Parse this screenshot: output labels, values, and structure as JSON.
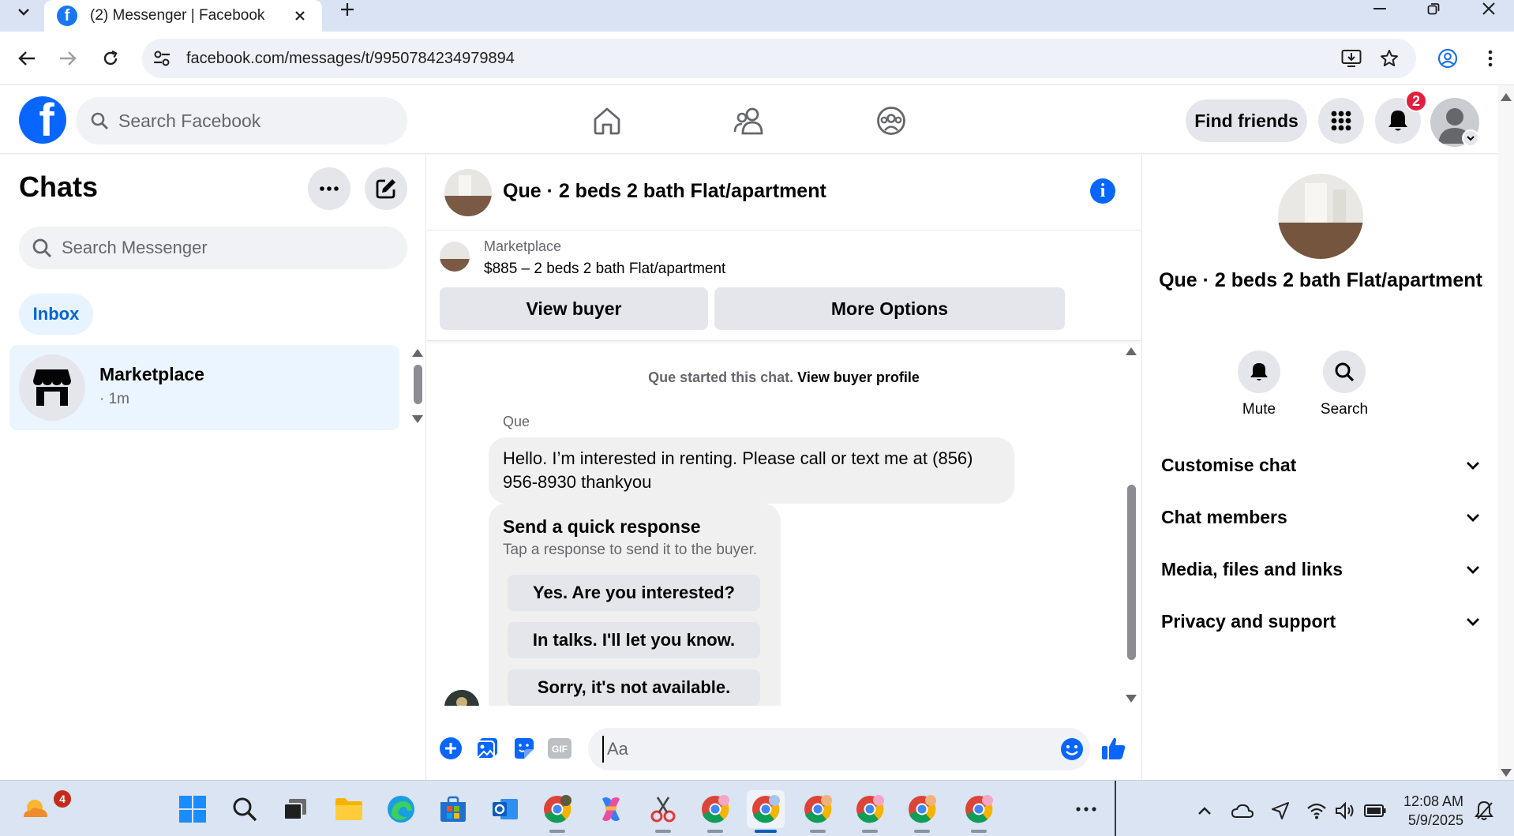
{
  "browser": {
    "tab_title": "(2) Messenger | Facebook",
    "url": "facebook.com/messages/t/9950784234979894"
  },
  "fb_nav": {
    "search_placeholder": "Search Facebook",
    "find_friends": "Find friends",
    "notification_count": "2"
  },
  "chats": {
    "title": "Chats",
    "search_placeholder": "Search Messenger",
    "inbox_label": "Inbox",
    "items": [
      {
        "name": "Marketplace",
        "time": "· 1m"
      }
    ]
  },
  "conversation": {
    "title": "Que · 2 beds 2 bath Flat/apartment",
    "listing": {
      "source": "Marketplace",
      "price_line": "$885 – 2 beds 2 bath Flat/apartment"
    },
    "buttons": {
      "view_buyer": "View buyer",
      "more_options": "More Options"
    },
    "started_text": "Que started this chat.",
    "view_buyer_profile": "View buyer profile",
    "sender": "Que",
    "message": "Hello. I’m interested in renting. Please call or text me at (856) 956-8930 thankyou",
    "quick_response": {
      "title": "Send a quick response",
      "subtitle": "Tap a response to send it to the buyer.",
      "options": [
        "Yes. Are you interested?",
        "In talks. I'll let you know.",
        "Sorry, it's not available."
      ]
    },
    "composer_placeholder": "Aa",
    "gif_label": "GIF"
  },
  "details": {
    "name": "Que · 2 beds 2 bath Flat/apartment",
    "actions": [
      {
        "label": "Mute",
        "icon": "bell-icon"
      },
      {
        "label": "Search",
        "icon": "search-icon"
      }
    ],
    "sections": [
      "Customise chat",
      "Chat members",
      "Media, files and links",
      "Privacy and support"
    ]
  },
  "taskbar": {
    "weather_badge": "4",
    "time": "12:08 AM",
    "date": "5/9/2025"
  },
  "colors": {
    "facebook_blue": "#0866ff",
    "badge_red": "#e41e3f",
    "inbox_text": "#0064d1",
    "selected_chat_bg": "#ebf5ff"
  }
}
